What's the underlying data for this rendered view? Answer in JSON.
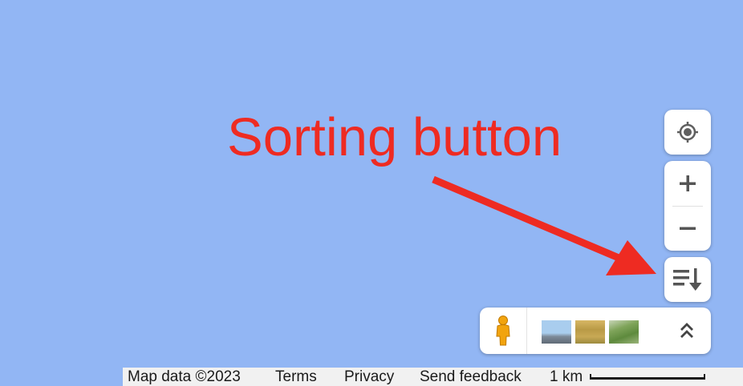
{
  "annotation": {
    "text": "Sorting button",
    "color": "#ee2b22"
  },
  "map": {
    "background_color": "#92b6f4"
  },
  "controls": {
    "locate_icon": "my-location-icon",
    "zoom_in_icon": "plus-icon",
    "zoom_out_icon": "minus-icon",
    "sort_icon": "sort-list-down-icon",
    "pegman_icon": "pegman-icon",
    "layer_thumbnails": [
      "layer-thumbnail-1",
      "layer-thumbnail-2",
      "layer-thumbnail-3"
    ],
    "expand_icon": "double-chevron-up-icon"
  },
  "footer": {
    "map_data": "Map data ©2023",
    "terms": "Terms",
    "privacy": "Privacy",
    "send_feedback": "Send feedback",
    "scale_label": "1 km"
  }
}
